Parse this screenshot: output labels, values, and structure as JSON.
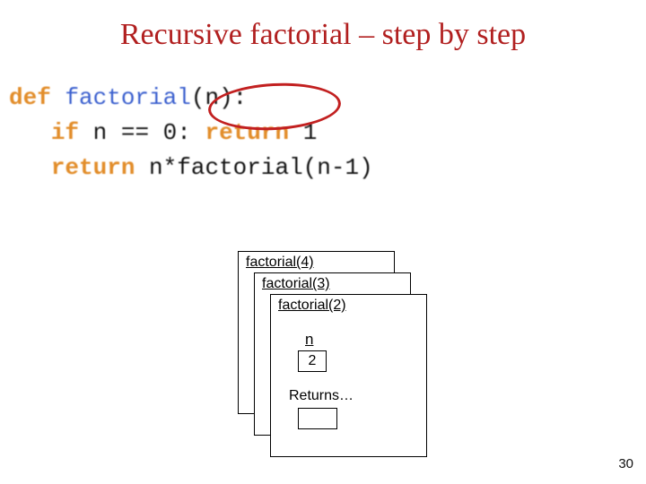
{
  "title": "Recursive factorial – step by step",
  "code": {
    "line1_def": "def",
    "line1_fn": "factorial",
    "line1_rest": "(n):",
    "line2_if": "if",
    "line2_cond": " n == 0: ",
    "line2_ret": "return",
    "line2_val": " 1",
    "line3_ret": "return",
    "line3_expr": " n*factorial(n-1)"
  },
  "stack": {
    "f1_label": "factorial(4)",
    "f2_label": "factorial(3)",
    "f3_label": "factorial(2)",
    "var_name": "n",
    "var_value": "2",
    "returns_label": "Returns…"
  },
  "page_number": "30"
}
